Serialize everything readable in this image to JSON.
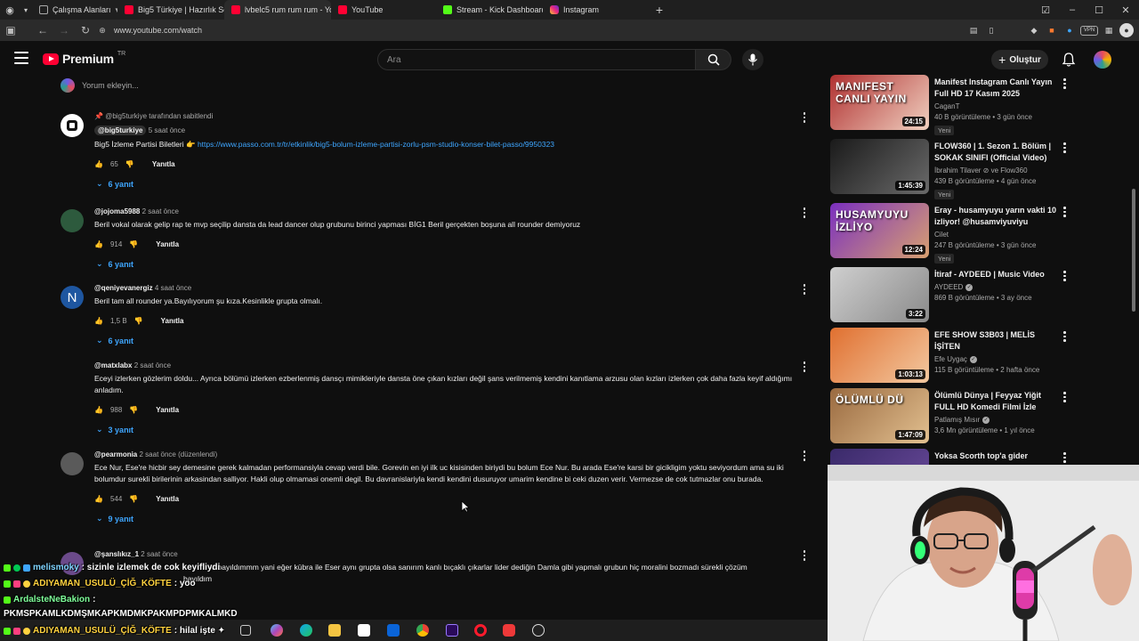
{
  "browser": {
    "tabs": [
      {
        "label": "Çalışma Alanları",
        "color": "#5f6368"
      },
      {
        "label": "Big5 Türkiye | Hazırlık Sezo",
        "color": "#ff0033"
      },
      {
        "label": "lvbelc5 rum rum rum - You",
        "color": "#ff0033",
        "active": true
      },
      {
        "label": "YouTube",
        "color": "#ff0033"
      },
      {
        "label": "Stream - Kick Dashboard",
        "color": "#53fc18"
      },
      {
        "label": "Instagram",
        "color": "#e1306c"
      }
    ],
    "new_tab": "+",
    "url": "www.youtube.com/watch"
  },
  "header": {
    "logo_text": "Premium",
    "logo_region": "TR",
    "search_placeholder": "Ara",
    "create_label": "Oluştur"
  },
  "comments": {
    "add_placeholder": "Yorum ekleyin...",
    "items": [
      {
        "pinned": "@big5turkiye tarafından sabitlendi",
        "author": "@big5turkiye",
        "time": "5 saat önce",
        "text": "Big5 İzleme Partisi Biletleri 👉",
        "link": "https://www.passo.com.tr/tr/etkinlik/big5-bolum-izleme-partisi-zorlu-psm-studio-konser-bilet-passo/9950323",
        "likes": "65",
        "reply": "Yanıtla",
        "replies": "6 yanıt"
      },
      {
        "author": "@jojoma5988",
        "time": "2 saat önce",
        "text": "Beril vokal olarak gelip rap te mvp seçilip dansta da lead dancer olup grubunu birinci yapması BİG1 Beril gerçekten boşuna all rounder demiyoruz",
        "likes": "914",
        "reply": "Yanıtla",
        "replies": "6 yanıt"
      },
      {
        "author": "@qeniyevanergiz",
        "time": "4 saat önce",
        "avatar_letter": "N",
        "text": "Beril tam all rounder ya.Bayılıyorum şu kıza.Kesinlikle grupta olmalı.",
        "likes": "1,5 B",
        "reply": "Yanıtla",
        "replies": "6 yanıt"
      },
      {
        "author": "@matxlabx",
        "time": "2 saat önce",
        "text": "Eceyi izlerken gözlerim doldu... Ayrıca bölümü izlerken ezberlenmiş dansçı mimikleriyle dansta öne çıkan kızları değil şans verilmemiş kendini kanıtlama arzusu olan kızları izlerken çok daha fazla keyif aldığımı anladım.",
        "likes": "988",
        "reply": "Yanıtla",
        "replies": "3 yanıt"
      },
      {
        "author": "@pearmonia",
        "time": "2 saat önce (düzenlendi)",
        "text": "Ece Nur, Ese're hicbir sey demesine gerek kalmadan performansiyla cevap verdi bile. Gorevin en iyi ilk uc kisisinden biriydi bu bolum Ece Nur. Bu arada Ese're karsi bir gicikligim yoktu seviyordum ama su iki bolumdur surekli birilerinin arkasindan salliyor. Hakli olup olmamasi onemli degil. Bu davranislariyla kendi kendini dusuruyor umarim kendine bi ceki duzen verir. Vermezse de cok tutmazlar onu burada.",
        "likes": "544",
        "reply": "Yanıtla",
        "replies": "9 yanıt"
      },
      {
        "author": "@şanslıkız_1",
        "time": "2 saat önce",
        "text": "ki bayıldımmm yani eğer kübra ile Eser aynı grupta olsa sanırım kanlı bıçaklı çıkarlar lider dediğin Damla gibi yapmalı grubun hiç moralini bozmadı sürekli çözüm",
        "text2": "bayıldım"
      }
    ]
  },
  "recommendations": [
    {
      "title": "Manifest Instagram Canlı Yayın Full HD 17 Kasım 2025",
      "channel": "CaganT",
      "verified": false,
      "views": "40 B görüntüleme",
      "age": "3 gün önce",
      "badge": "Yeni",
      "duration": "24:15",
      "overlay": "MANIFEST CANLI YAYIN",
      "c1": "#b03030",
      "c2": "#f0d0c0"
    },
    {
      "title": "FLOW360 | 1. Sezon 1. Bölüm | SOKAK SINIFI (Official Video)",
      "channel": "İbrahim Tilaver ⊘ ve Flow360",
      "verified": false,
      "views": "439 B görüntüleme",
      "age": "4 gün önce",
      "badge": "Yeni",
      "duration": "1:45:39",
      "overlay": "",
      "c1": "#1a1a1a",
      "c2": "#6a6a6a"
    },
    {
      "title": "Eray - husamyuyu yarın vakti 10 izliyor! @husamviyuviyu",
      "channel": "Cilet",
      "verified": false,
      "views": "247 B görüntüleme",
      "age": "3 gün önce",
      "badge": "Yeni",
      "duration": "12:24",
      "overlay": "HUSAMYUYU İZLİYO",
      "c1": "#7a2fbf",
      "c2": "#d8a070"
    },
    {
      "title": "İtiraf - AYDEED | Music Video",
      "channel": "AYDEED",
      "verified": true,
      "views": "869 B görüntüleme",
      "age": "3 ay önce",
      "badge": "",
      "duration": "3:22",
      "overlay": "",
      "c1": "#cfcfcf",
      "c2": "#8a8a8a"
    },
    {
      "title": "EFE SHOW S3B03 | MELİS İŞİTEN",
      "channel": "Efe Uygaç",
      "verified": true,
      "views": "115 B görüntüleme",
      "age": "2 hafta önce",
      "badge": "",
      "duration": "1:03:13",
      "overlay": "",
      "c1": "#e07030",
      "c2": "#f3c8a0"
    },
    {
      "title": "Ölümlü Dünya | Feyyaz Yiğit FULL HD Komedi Filmi İzle",
      "channel": "Patlamış Mısır",
      "verified": true,
      "views": "3,6 Mn görüntüleme",
      "age": "1 yıl önce",
      "badge": "",
      "duration": "1:47:09",
      "overlay": "ÖLÜMLÜ DÜ",
      "c1": "#9a6a40",
      "c2": "#e2c090"
    },
    {
      "title": "Yoksa Scorth top'a gider",
      "channel": "",
      "verified": false,
      "views": "",
      "age": "",
      "badge": "",
      "duration": "",
      "overlay": "",
      "c1": "#3a2a6a",
      "c2": "#6a4a9a"
    }
  ],
  "chat": [
    {
      "user": "melismoky",
      "msg": ": sizinle izlemek de cok keyifliydi",
      "color": "#7fd4ff"
    },
    {
      "user": "ADIYAMAN_USULÜ_ÇİĞ_KÖFTE",
      "msg": ": yoo",
      "color": "#ffd23f"
    },
    {
      "user": "ArdalsteNeBakion",
      "msg": ":",
      "color": "#7fff9a"
    },
    {
      "user": "",
      "msg": "PKMSPKAMLKDMŞMKAPKMDMKPAKMPDPMKALMKD",
      "color": "#ffffff"
    },
    {
      "user": "ADIYAMAN_USULÜ_ÇİĞ_KÖFTE",
      "msg": ": hilal işte ✦",
      "color": "#ffd23f"
    }
  ]
}
